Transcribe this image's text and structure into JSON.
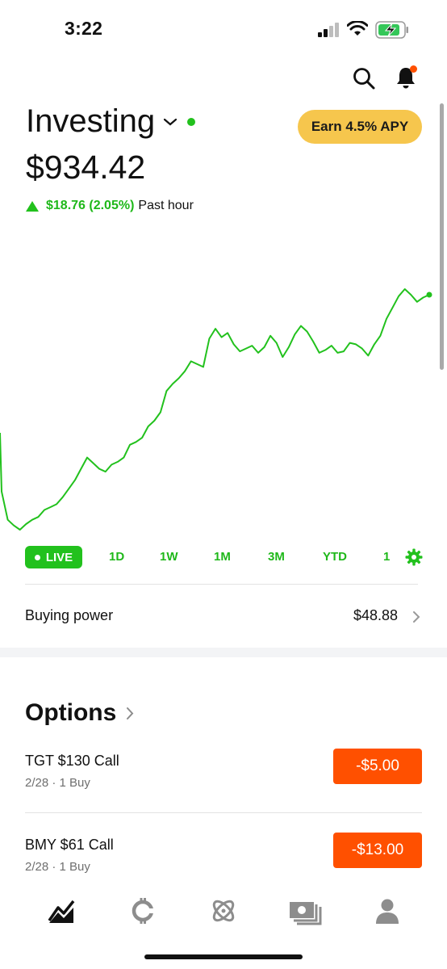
{
  "status_bar": {
    "time": "3:22"
  },
  "header": {
    "title": "Investing",
    "apy_label": "Earn 4.5% APY",
    "portfolio_value": "$934.42",
    "change_amount": "$18.76 (2.05%)",
    "change_period": "Past hour"
  },
  "colors": {
    "gain": "#22c11d",
    "accent_orange": "#ff5000",
    "apy_yellow": "#f6c64d"
  },
  "chart_data": {
    "type": "line",
    "series": [
      {
        "values": [
          60,
          40,
          36,
          33,
          37,
          40,
          42,
          47,
          49,
          51,
          56,
          62,
          68,
          76,
          84,
          80,
          76,
          74,
          79,
          81,
          84,
          93,
          95,
          98,
          106,
          110,
          116,
          131,
          136,
          140,
          145,
          152,
          150,
          148,
          168,
          175,
          169,
          172,
          164,
          159,
          161,
          163,
          158,
          162,
          170,
          165,
          155,
          162,
          171,
          177,
          173,
          166,
          158,
          160,
          163,
          158,
          159,
          165,
          164,
          161,
          156,
          164,
          170,
          182,
          190,
          198,
          203,
          199,
          194,
          197,
          199
        ]
      }
    ]
  },
  "ranges": [
    "LIVE",
    "1D",
    "1W",
    "1M",
    "3M",
    "YTD",
    "1"
  ],
  "selected_range": "LIVE",
  "buying_power": {
    "label": "Buying power",
    "value": "$48.88"
  },
  "options": {
    "title": "Options",
    "items": [
      {
        "name": "TGT $130 Call",
        "sub": "2/28 · 1 Buy",
        "pnl": "-$5.00"
      },
      {
        "name": "BMY $61 Call",
        "sub": "2/28 · 1 Buy",
        "pnl": "-$13.00"
      }
    ]
  },
  "bottom_nav": [
    "investing-icon",
    "crypto-icon",
    "browse-icon",
    "transfers-icon",
    "account-icon"
  ]
}
